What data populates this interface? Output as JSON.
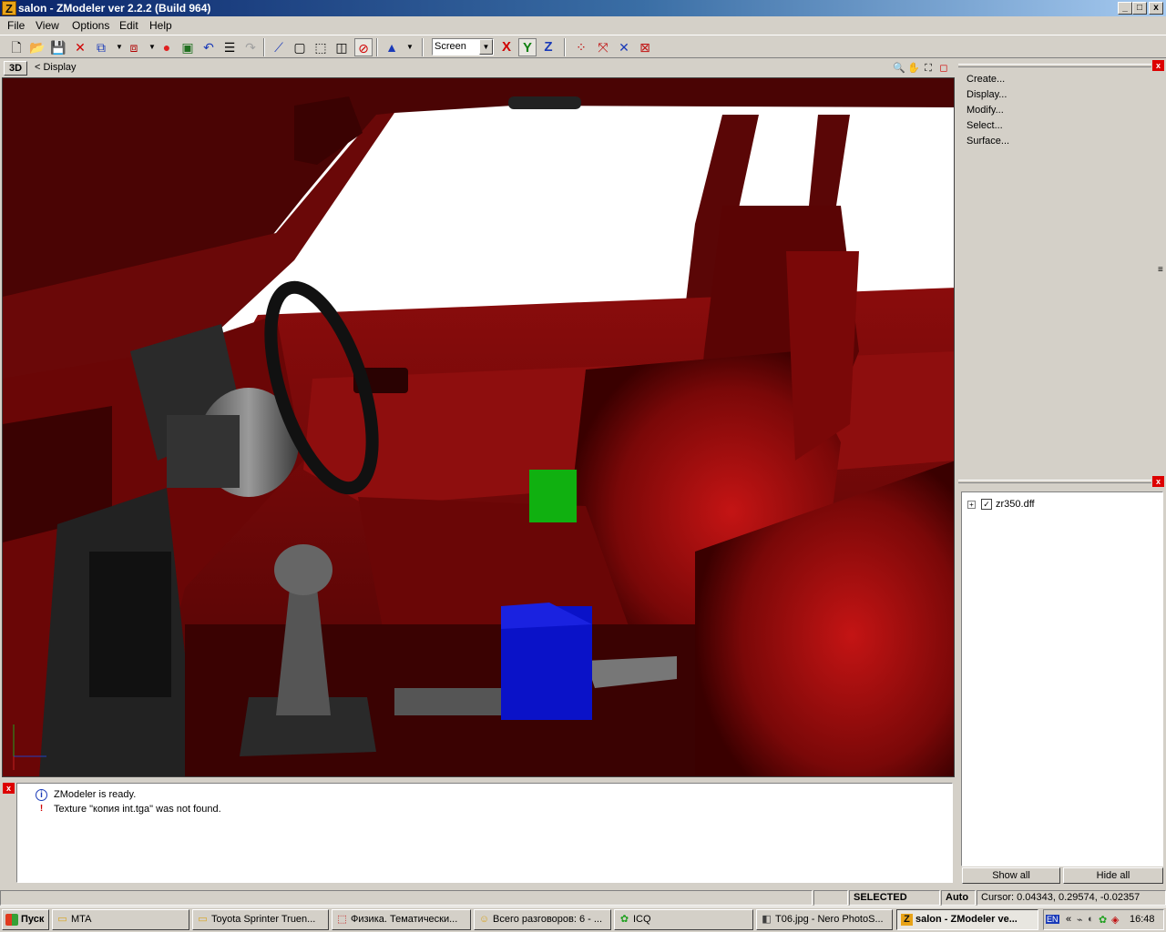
{
  "window": {
    "title": "salon - ZModeler ver 2.2.2 (Build 964)",
    "app_icon": "Z",
    "minimize": "_",
    "maximize": "□",
    "close": "x"
  },
  "menu": {
    "file": "File",
    "view": "View",
    "options": "Options",
    "edit": "Edit",
    "help": "Help"
  },
  "toolbar": {
    "coord_system": "Screen",
    "axis_x": "X",
    "axis_y": "Y",
    "axis_z": "Z"
  },
  "viewport": {
    "mode": "3D",
    "label": "<  Display"
  },
  "command_panel": {
    "items": [
      "Create...",
      "Display...",
      "Modify...",
      "Select...",
      "Surface..."
    ]
  },
  "object_tree": {
    "root_label": "zr350.dff",
    "checked_mark": "✓",
    "expand_mark": "+",
    "show_all": "Show all",
    "hide_all": "Hide all"
  },
  "log": {
    "lines": [
      {
        "icon": "i",
        "text": "ZModeler is ready."
      },
      {
        "icon": "!",
        "text": "Texture \"копия int.tga\" was not found."
      }
    ]
  },
  "status": {
    "mode": "SELECTED MODE",
    "snap": "Auto",
    "cursor": "Cursor: 0.04343, 0.29574, -0.02357"
  },
  "taskbar": {
    "start": "Пуск",
    "tasks": [
      {
        "label": "MTA",
        "icon": "folder"
      },
      {
        "label": "Toyota Sprinter Truen...",
        "icon": "folder"
      },
      {
        "label": "Физика. Тематически...",
        "icon": "pdf"
      },
      {
        "label": "Всего разговоров: 6 - ...",
        "icon": "chat"
      },
      {
        "label": "ICQ",
        "icon": "icq"
      },
      {
        "label": "T06.jpg - Nero PhotoS...",
        "icon": "image"
      },
      {
        "label": "salon - ZModeler ve...",
        "icon": "zmodeler"
      }
    ],
    "lang": "EN",
    "tray_arrows": "«",
    "clock": "16:48"
  },
  "colors": {
    "title_start": "#0a246a",
    "title_end": "#a6caf0",
    "interior_red": "#7a0a0a",
    "green_helper": "#10b010",
    "blue_helper": "#0a12c8"
  }
}
